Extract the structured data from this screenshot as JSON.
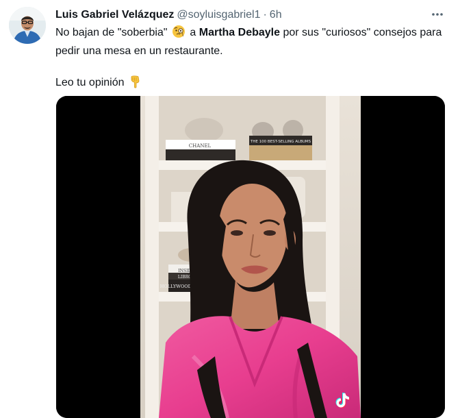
{
  "tweet": {
    "author_name": "Luis Gabriel Velázquez",
    "author_handle": "@soyluisgabriel1",
    "separator": "·",
    "time": "6h",
    "text": {
      "part1": "No bajan de \"soberbia\"",
      "part2": "a",
      "mention": "Martha Debayle",
      "part3": "por sus \"curiosos\" consejos para pedir una mesa en un restaurante.",
      "line2": "Leo tu opinión"
    },
    "media": {
      "shelf_book_1": "CHANEL",
      "shelf_book_2": "THE 100 BEST-SELLING ALBUMS",
      "shelf_book_3": "LIBROS",
      "shelf_book_4": "HOLLYWOOD MOVIES",
      "shelf_book_5": "INSIDE"
    }
  },
  "icons": {
    "more": "more-dots-icon",
    "emoji1": "face-with-monocle-emoji",
    "emoji2": "backhand-index-pointing-down-emoji",
    "watermark": "tiktok-logo-icon"
  },
  "colors": {
    "text": "#0f1419",
    "secondary": "#536471",
    "dress": "#e83e8f",
    "emoji": "#f7c53f"
  }
}
